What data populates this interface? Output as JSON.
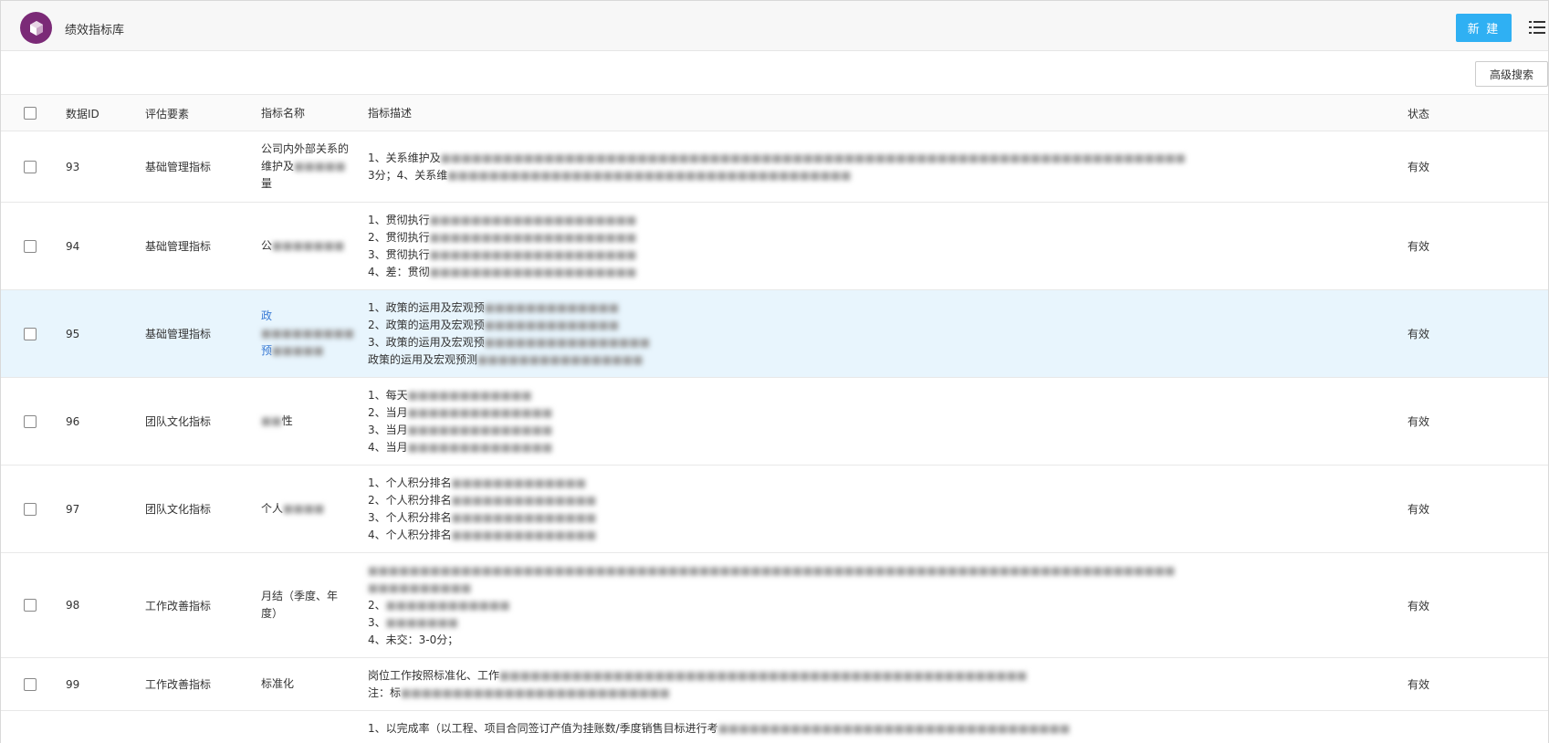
{
  "header": {
    "app_title": "绩效指标库",
    "new_button": "新 建",
    "brand_color": "#7b2a77",
    "accent_color": "#2fb0f3"
  },
  "toolbar": {
    "advanced_search": "高级搜索"
  },
  "table": {
    "columns": {
      "id": "数据ID",
      "element": "评估要素",
      "name": "指标名称",
      "desc": "指标描述",
      "status": "状态"
    },
    "rows": [
      {
        "id": "93",
        "element": "基础管理指标",
        "name": [
          "公司内外部关系的",
          "维护及■■■■■",
          "量"
        ],
        "desc": [
          "1、关系维护及■■■■■■■■■■■■■■■■■■■■■■■■■■■■■■■■■■■■■■■■■■■■■■■■■■■■■■■■■■■■■■■■■■■■■■■■",
          "3分；4、关系维■■■■■■■■■■■■■■■■■■■■■■■■■■■■■■■■■■■■■■■"
        ],
        "status": "有效"
      },
      {
        "id": "94",
        "element": "基础管理指标",
        "name": [
          "公■■■■■■■"
        ],
        "desc": [
          "1、贯彻执行■■■■■■■■■■■■■■■■■■■■",
          "2、贯彻执行■■■■■■■■■■■■■■■■■■■■",
          "3、贯彻执行■■■■■■■■■■■■■■■■■■■■",
          "4、差：贯彻■■■■■■■■■■■■■■■■■■■■"
        ],
        "status": "有效"
      },
      {
        "id": "95",
        "element": "基础管理指标",
        "name": [
          "政■■■■■■■■■",
          "预■■■■■"
        ],
        "desc": [
          "1、政策的运用及宏观预■■■■■■■■■■■■■",
          "2、政策的运用及宏观预■■■■■■■■■■■■■",
          "3、政策的运用及宏观预■■■■■■■■■■■■■■■■",
          "政策的运用及宏观预测■■■■■■■■■■■■■■■■"
        ],
        "status": "有效"
      },
      {
        "id": "96",
        "element": "团队文化指标",
        "name": [
          "■■性"
        ],
        "desc": [
          "1、每天■■■■■■■■■■■■",
          "2、当月■■■■■■■■■■■■■■",
          "3、当月■■■■■■■■■■■■■■",
          "4、当月■■■■■■■■■■■■■■"
        ],
        "status": "有效"
      },
      {
        "id": "97",
        "element": "团队文化指标",
        "name": [
          "个人■■■■"
        ],
        "desc": [
          "1、个人积分排名■■■■■■■■■■■■■",
          "2、个人积分排名■■■■■■■■■■■■■■",
          "3、个人积分排名■■■■■■■■■■■■■■",
          "4、个人积分排名■■■■■■■■■■■■■■"
        ],
        "status": "有效"
      },
      {
        "id": "98",
        "element": "工作改善指标",
        "name": [
          "月结（季度、年",
          "度）"
        ],
        "desc": [
          "■■■■■■■■■■■■■■■■■■■■■■■■■■■■■■■■■■■■■■■■■■■■■■■■■■■■■■■■■■■■■■■■■■■■■■■■■■■■■■",
          "■■■■■■■■■■",
          "2、■■■■■■■■■■■■",
          "3、■■■■■■■",
          "4、未交：3-0分；"
        ],
        "status": "有效"
      },
      {
        "id": "99",
        "element": "工作改善指标",
        "name": [
          "标准化"
        ],
        "desc": [
          "岗位工作按照标准化、工作■■■■■■■■■■■■■■■■■■■■■■■■■■■■■■■■■■■■■■■■■■■■■■■■■■■",
          "注：标■■■■■■■■■■■■■■■■■■■■■■■■■■"
        ],
        "status": "有效"
      },
      {
        "id": "",
        "element": "",
        "name": [
          ""
        ],
        "desc": [
          "1、以完成率（以工程、项目合同签订产值为挂账数/季度销售目标进行考■■■■■■■■■■■■■■■■■■■■■■■■■■■■■■■■■■"
        ],
        "status": ""
      }
    ]
  }
}
